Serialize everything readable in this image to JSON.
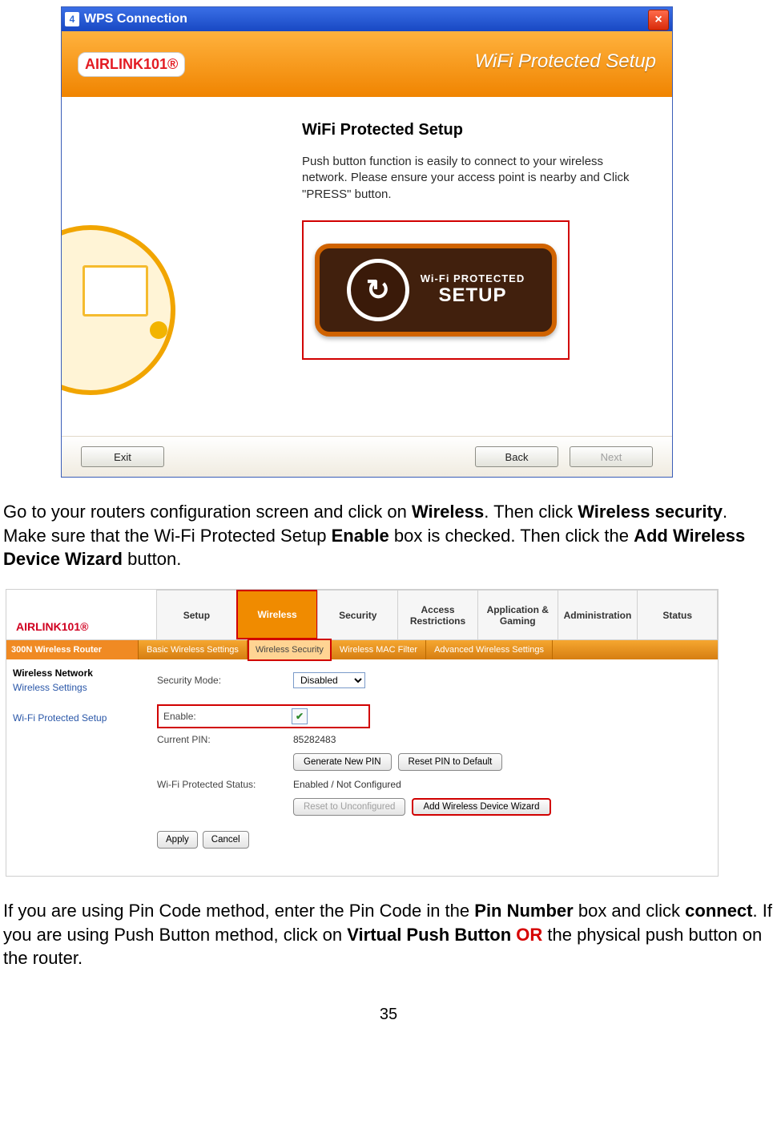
{
  "dialog": {
    "title": "WPS Connection",
    "icon_label": "4",
    "brand_logo_text": "AIRLINK101®",
    "banner_title": "WiFi Protected Setup",
    "heading": "WiFi Protected Setup",
    "paragraph": "Push button function is easily to connect to your wireless network. Please ensure your access point is nearby and Click \"PRESS\" button.",
    "badge_line1": "Wi-Fi PROTECTED",
    "badge_line2": "SETUP",
    "buttons": {
      "exit": "Exit",
      "back": "Back",
      "next": "Next"
    }
  },
  "doc": {
    "para1": {
      "t1": "Go to your routers configuration screen and click on ",
      "b1": "Wireless",
      "t2": ".  Then click ",
      "b2": "Wireless security",
      "t3": ".  Make sure that the Wi-Fi Protected Setup ",
      "b3": "Enable",
      "t4": " box is checked.  Then click the ",
      "b4": "Add Wireless Device Wizard",
      "t5": " button."
    },
    "para2": {
      "t1": "If you are using Pin Code method, enter the Pin Code in the ",
      "b1": "Pin Number",
      "t2": " box and click ",
      "b2": "connect",
      "t3": ".  If you are using Push Button method, click on ",
      "b3": "Virtual Push Button",
      "or": " OR ",
      "t4": "the physical push button on the router."
    },
    "page_number": "35"
  },
  "router": {
    "logo_text": "AIRLINK101®",
    "product_name": "300N Wireless Router",
    "main_tabs": [
      "Setup",
      "Wireless",
      "Security",
      "Access Restrictions",
      "Application & Gaming",
      "Administration",
      "Status"
    ],
    "sub_tabs": [
      "Basic Wireless Settings",
      "Wireless Security",
      "Wireless MAC Filter",
      "Advanced Wireless Settings"
    ],
    "sidebar": {
      "heading": "Wireless Network",
      "link1": "Wireless Settings",
      "link2": "Wi-Fi Protected Setup"
    },
    "fields": {
      "security_mode_label": "Security Mode:",
      "security_mode_value": "Disabled",
      "enable_label": "Enable:",
      "current_pin_label": "Current PIN:",
      "current_pin_value": "85282483",
      "status_label": "Wi-Fi Protected Status:",
      "status_value": "Enabled / Not Configured"
    },
    "buttons": {
      "gen_pin": "Generate New PIN",
      "reset_pin": "Reset PIN to Default",
      "reset_unconf": "Reset to Unconfigured",
      "add_wizard": "Add Wireless Device Wizard",
      "apply": "Apply",
      "cancel": "Cancel"
    }
  }
}
